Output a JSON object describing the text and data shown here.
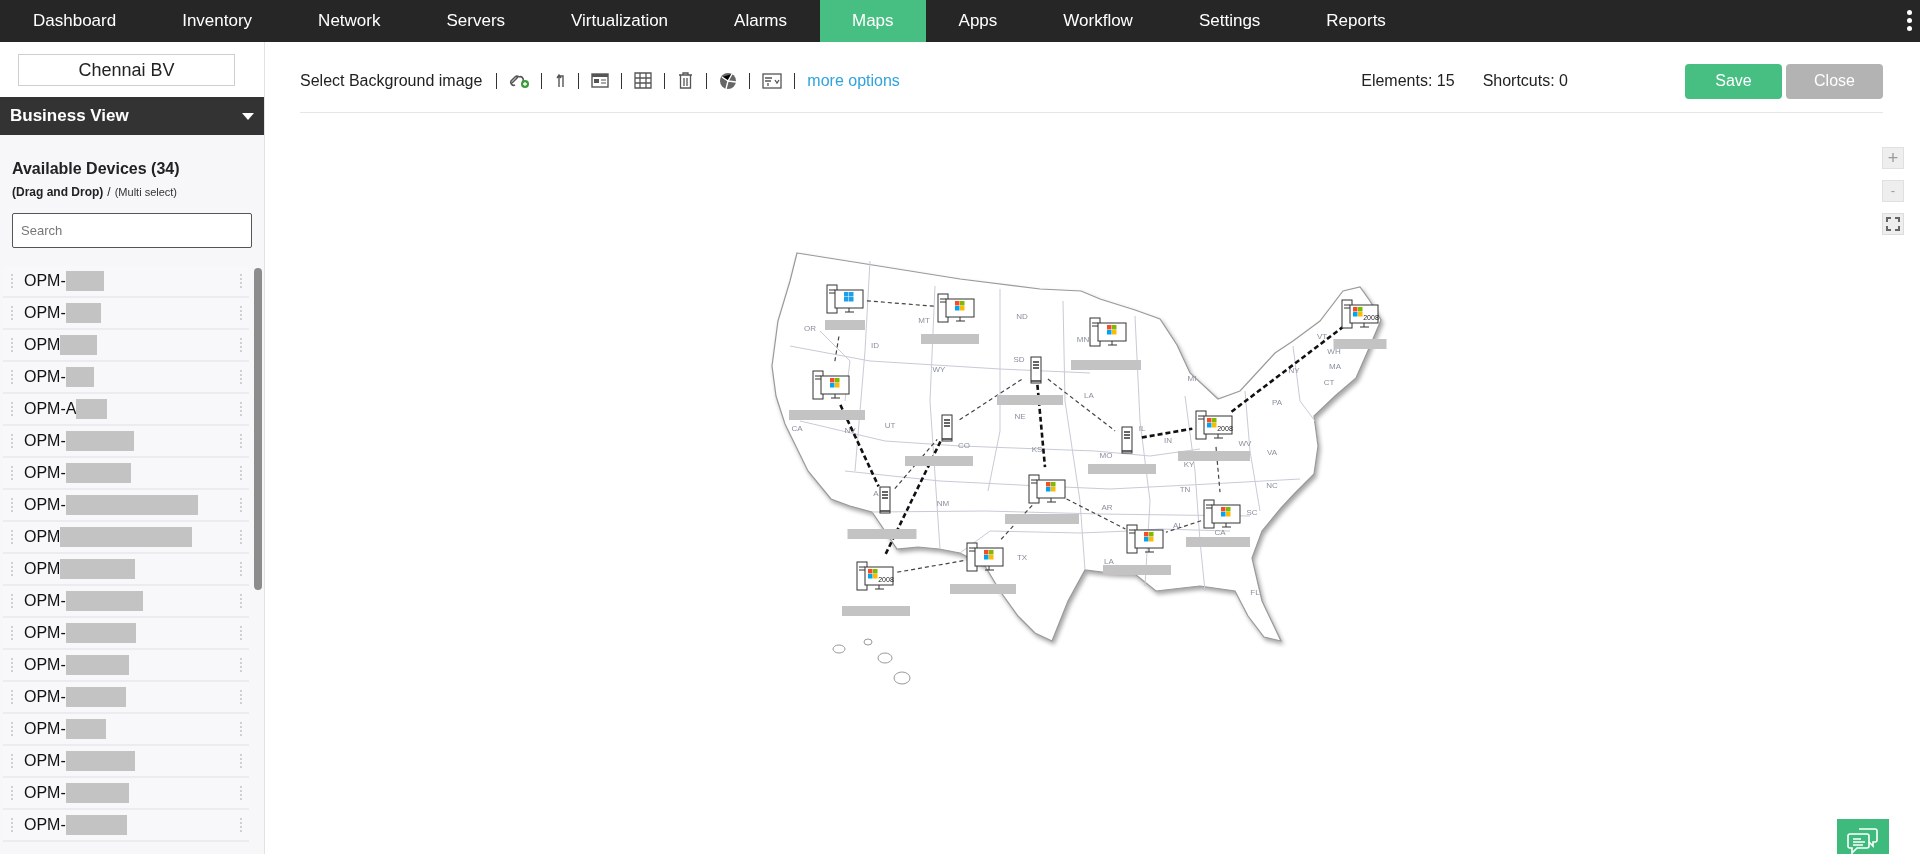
{
  "nav": [
    {
      "label": "Dashboard",
      "selected": false
    },
    {
      "label": "Inventory",
      "selected": false
    },
    {
      "label": "Network",
      "selected": false
    },
    {
      "label": "Servers",
      "selected": false
    },
    {
      "label": "Virtualization",
      "selected": false
    },
    {
      "label": "Alarms",
      "selected": false
    },
    {
      "label": "Maps",
      "selected": true
    },
    {
      "label": "Apps",
      "selected": false
    },
    {
      "label": "Workflow",
      "selected": false
    },
    {
      "label": "Settings",
      "selected": false
    },
    {
      "label": "Reports",
      "selected": false
    }
  ],
  "sidebar": {
    "view_name": "Chennai BV",
    "dropdown": "Business View",
    "heading": "Available Devices (34)",
    "hint_bold": "(Drag and Drop)",
    "hint_sep": "/",
    "hint_small": "(Multi select)",
    "search": {
      "placeholder": "Search"
    },
    "devices": [
      {
        "name": "OPM-"
      },
      {
        "name": "OPM-"
      },
      {
        "name": "OPM"
      },
      {
        "name": "OPM-"
      },
      {
        "name": "OPM-A"
      },
      {
        "name": "OPM-"
      },
      {
        "name": "OPM-"
      },
      {
        "name": "OPM-"
      },
      {
        "name": "OPM"
      },
      {
        "name": "OPM"
      },
      {
        "name": "OPM-"
      },
      {
        "name": "OPM-"
      },
      {
        "name": "OPM-"
      },
      {
        "name": "OPM-"
      },
      {
        "name": "OPM-"
      },
      {
        "name": "OPM-"
      },
      {
        "name": "OPM-"
      },
      {
        "name": "OPM-"
      }
    ]
  },
  "toolbar": {
    "background_label": "Select Background image",
    "more": "more options",
    "elements": "Elements: 15",
    "shortcuts": "Shortcuts: 0",
    "save": "Save",
    "close": "Close"
  },
  "zoom_controls": {
    "plus": "+",
    "minus": "-"
  },
  "map": {
    "states": [
      "OR",
      "ID",
      "MT",
      "ND",
      "MN",
      "WY",
      "SD",
      "NV",
      "UT",
      "CO",
      "CA",
      "NE",
      "LA",
      "IL",
      "IN",
      "MI",
      "KS",
      "MO",
      "KY",
      "WV",
      "VA",
      "PA",
      "NY",
      "VT",
      "WH",
      "MA",
      "CT",
      "TN",
      "NC",
      "SC",
      "AL",
      "CA",
      "AR",
      "NM",
      "A",
      "TX",
      "LA",
      "FL"
    ],
    "devices": [
      {
        "kind": "modern-pc"
      },
      {
        "kind": "pc"
      },
      {
        "kind": "pc"
      },
      {
        "kind": "pc",
        "badge": "2008"
      },
      {
        "kind": "pc"
      },
      {
        "kind": "server"
      },
      {
        "kind": "server"
      },
      {
        "kind": "server"
      },
      {
        "kind": "pc",
        "badge": "2008"
      },
      {
        "kind": "server"
      },
      {
        "kind": "pc"
      },
      {
        "kind": "pc"
      },
      {
        "kind": "pc"
      },
      {
        "kind": "pc"
      },
      {
        "kind": "pc",
        "badge": "2008"
      }
    ]
  }
}
